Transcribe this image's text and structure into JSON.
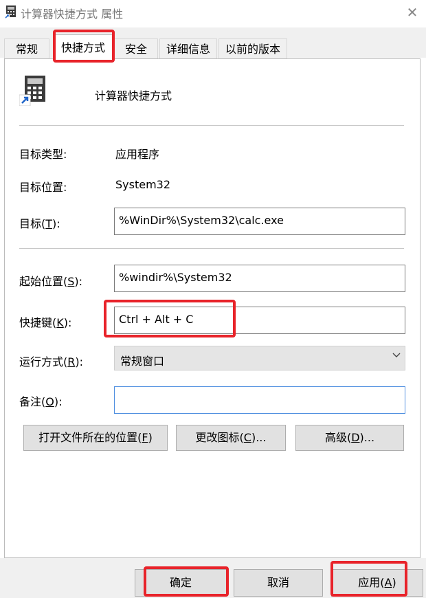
{
  "window": {
    "title": "计算器快捷方式 属性",
    "close_glyph": "✕"
  },
  "tabs": [
    {
      "label": "常规",
      "active": false
    },
    {
      "label": "快捷方式",
      "active": true
    },
    {
      "label": "安全",
      "active": false
    },
    {
      "label": "详细信息",
      "active": false
    },
    {
      "label": "以前的版本",
      "active": false
    }
  ],
  "shortcut": {
    "name": "计算器快捷方式",
    "icon": "calculator-shortcut-icon"
  },
  "fields": {
    "target_type_label": "目标类型:",
    "target_type_value": "应用程序",
    "target_location_label": "目标位置:",
    "target_location_value": "System32",
    "target_label_pre": "目标(",
    "target_label_key": "T",
    "target_label_post": "):",
    "target_value": "%WinDir%\\System32\\calc.exe",
    "start_in_label_pre": "起始位置(",
    "start_in_label_key": "S",
    "start_in_label_post": "):",
    "start_in_value": "%windir%\\System32",
    "hotkey_label_pre": "快捷键(",
    "hotkey_label_key": "K",
    "hotkey_label_post": "):",
    "hotkey_value": "Ctrl + Alt + C",
    "run_label_pre": "运行方式(",
    "run_label_key": "R",
    "run_label_post": "):",
    "run_value": "常规窗口",
    "comment_label_pre": "备注(",
    "comment_label_key": "O",
    "comment_label_post": "):",
    "comment_value": ""
  },
  "buttons": {
    "open_location_pre": "打开文件所在的位置(",
    "open_location_key": "F",
    "open_location_post": ")",
    "change_icon_pre": "更改图标(",
    "change_icon_key": "C",
    "change_icon_post": ")...",
    "advanced_pre": "高级(",
    "advanced_key": "D",
    "advanced_post": ")..."
  },
  "footer": {
    "ok": "确定",
    "cancel": "取消",
    "apply_pre": "应用(",
    "apply_key": "A",
    "apply_post": ")"
  },
  "colors": {
    "highlight": "#e8232a",
    "focus_border": "#4f8fe0",
    "dialog_bg": "#f0f0f0"
  }
}
